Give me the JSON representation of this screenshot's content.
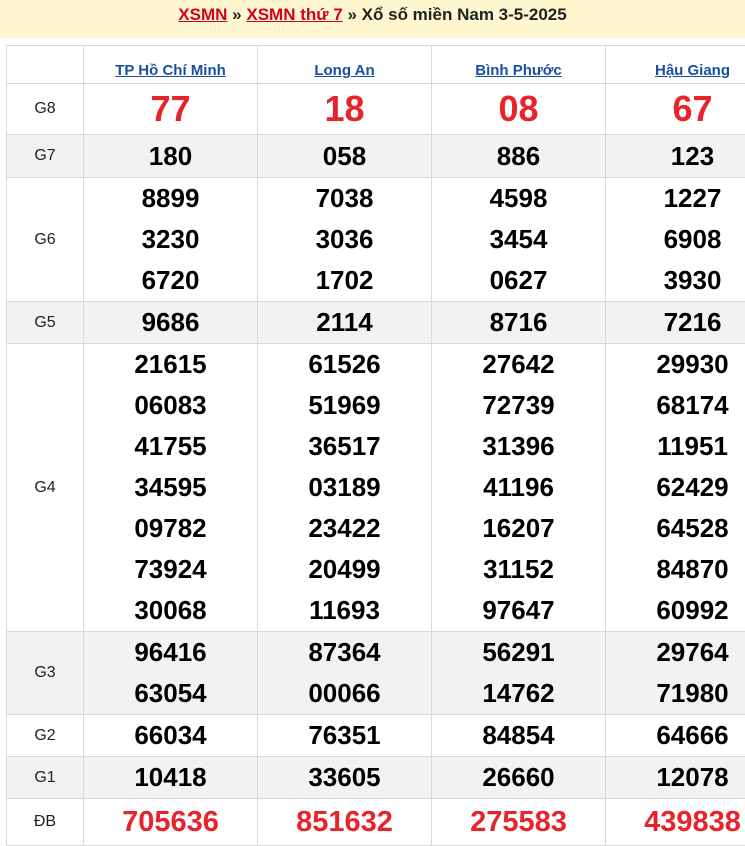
{
  "title": {
    "link1": "XSMN",
    "sep1": "»",
    "link2": "XSMN thứ 7",
    "sep2": "»",
    "text": "Xổ số miền Nam 3-5-2025"
  },
  "provinces": [
    "TP Hồ Chí Minh",
    "Long An",
    "Bình Phước",
    "Hậu Giang"
  ],
  "prizes": [
    {
      "label": "G8",
      "values": [
        [
          "77"
        ],
        [
          "18"
        ],
        [
          "08"
        ],
        [
          "67"
        ]
      ]
    },
    {
      "label": "G7",
      "values": [
        [
          "180"
        ],
        [
          "058"
        ],
        [
          "886"
        ],
        [
          "123"
        ]
      ]
    },
    {
      "label": "G6",
      "values": [
        [
          "8899",
          "3230",
          "6720"
        ],
        [
          "7038",
          "3036",
          "1702"
        ],
        [
          "4598",
          "3454",
          "0627"
        ],
        [
          "1227",
          "6908",
          "3930"
        ]
      ]
    },
    {
      "label": "G5",
      "values": [
        [
          "9686"
        ],
        [
          "2114"
        ],
        [
          "8716"
        ],
        [
          "7216"
        ]
      ]
    },
    {
      "label": "G4",
      "values": [
        [
          "21615",
          "06083",
          "41755",
          "34595",
          "09782",
          "73924",
          "30068"
        ],
        [
          "61526",
          "51969",
          "36517",
          "03189",
          "23422",
          "20499",
          "11693"
        ],
        [
          "27642",
          "72739",
          "31396",
          "41196",
          "16207",
          "31152",
          "97647"
        ],
        [
          "29930",
          "68174",
          "11951",
          "62429",
          "64528",
          "84870",
          "60992"
        ]
      ]
    },
    {
      "label": "G3",
      "values": [
        [
          "96416",
          "63054"
        ],
        [
          "87364",
          "00066"
        ],
        [
          "56291",
          "14762"
        ],
        [
          "29764",
          "71980"
        ]
      ]
    },
    {
      "label": "G2",
      "values": [
        [
          "66034"
        ],
        [
          "76351"
        ],
        [
          "84854"
        ],
        [
          "64666"
        ]
      ]
    },
    {
      "label": "G1",
      "values": [
        [
          "10418"
        ],
        [
          "33605"
        ],
        [
          "26660"
        ],
        [
          "12078"
        ]
      ]
    },
    {
      "label": "ĐB",
      "values": [
        [
          "705636"
        ],
        [
          "851632"
        ],
        [
          "275583"
        ],
        [
          "439838"
        ]
      ]
    }
  ]
}
